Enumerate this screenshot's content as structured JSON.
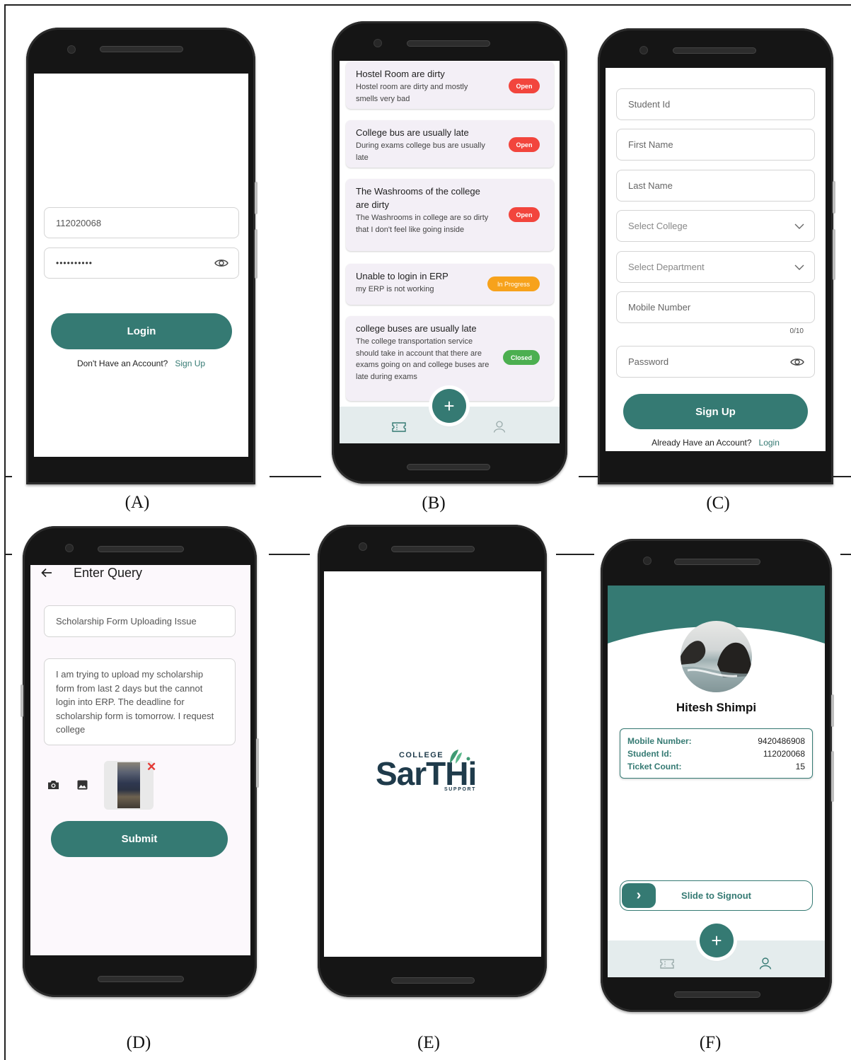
{
  "captions": [
    "(A)",
    "(B)",
    "(C)",
    "(D)",
    "(E)",
    "(F)"
  ],
  "colors": {
    "accent": "#357a73",
    "open": "#f2453d",
    "in_progress": "#f7a21b",
    "closed": "#4caf50"
  },
  "screen_a": {
    "student_id_value": "112020068",
    "password_value": "••••••••••",
    "password_icon": "eye-icon",
    "login_label": "Login",
    "no_account_text": "Don't Have an Account?",
    "signup_link": "Sign Up"
  },
  "screen_b": {
    "tickets": [
      {
        "title": "Hostel Room are dirty",
        "desc": "Hostel room are dirty and mostly smells very bad",
        "status": "Open"
      },
      {
        "title": "College bus are usually late",
        "desc": "During exams college bus are usually late",
        "status": "Open"
      },
      {
        "title": "The Washrooms of the college are dirty",
        "desc": "The Washrooms in college are so dirty that I don't feel like going inside",
        "status": "Open"
      },
      {
        "title": "Unable to login in ERP",
        "desc": "my ERP is not working",
        "status": "In Progress"
      },
      {
        "title": "college buses are usually late",
        "desc": "The college transportation service should take in account that there are exams going on and college buses are late during exams",
        "status": "Closed"
      }
    ],
    "fab_label": "+",
    "nav_icons": [
      "ticket-icon",
      "person-icon"
    ]
  },
  "screen_c": {
    "student_id_placeholder": "Student Id",
    "first_name_placeholder": "First Name",
    "last_name_placeholder": "Last Name",
    "college_placeholder": "Select College",
    "department_placeholder": "Select Department",
    "mobile_placeholder": "Mobile Number",
    "mobile_counter": "0/10",
    "password_placeholder": "Password",
    "signup_label": "Sign Up",
    "have_account_text": "Already Have an Account?",
    "login_link": "Login"
  },
  "screen_d": {
    "title": "Enter Query",
    "subject_value": "Scholarship Form Uploading Issue",
    "body_value": "I am trying to upload my scholarship form from last 2 days but the cannot login into ERP. The deadline for scholarship form is tomorrow. I request college",
    "submit_label": "Submit",
    "remove_mark": "✕"
  },
  "screen_e": {
    "logo_top": "COLLEGE",
    "logo_main": "SarTHi",
    "logo_bottom": "SUPPORT"
  },
  "screen_f": {
    "name": "Hitesh Shimpi",
    "mobile_label": "Mobile Number:",
    "mobile_value": "9420486908",
    "student_id_label": "Student Id:",
    "student_id_value": "112020068",
    "ticket_count_label": "Ticket Count:",
    "ticket_count_value": "15",
    "slide_label": "Slide to Signout",
    "slide_arrow": "›",
    "fab_label": "+"
  }
}
